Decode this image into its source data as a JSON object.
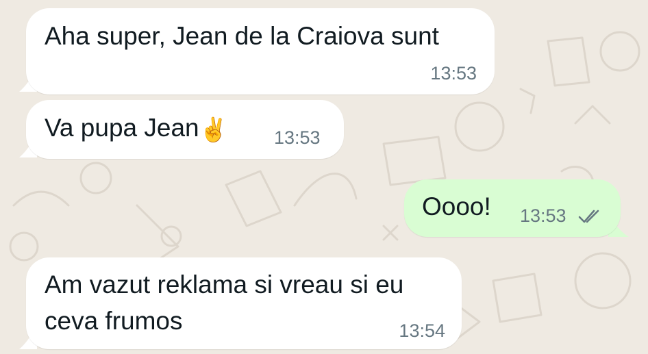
{
  "messages": [
    {
      "direction": "incoming",
      "text": "Aha super, Jean de la Craiova sunt",
      "time": "13:53"
    },
    {
      "direction": "incoming",
      "text": "Va pupa Jean",
      "emoji": "✌️",
      "time": "13:53"
    },
    {
      "direction": "outgoing",
      "text": "Oooo!",
      "time": "13:53",
      "status": "read",
      "status_icon": "double-check-icon"
    },
    {
      "direction": "incoming",
      "lines": [
        "Am vazut reklama si vreau si eu",
        "ceva frumos"
      ],
      "time": "13:54"
    }
  ],
  "colors": {
    "background": "#efeae2",
    "incoming_bubble": "#ffffff",
    "outgoing_bubble": "#d9fdd3",
    "text": "#111b21",
    "timestamp": "#667781",
    "read_ticks": "#667781"
  }
}
